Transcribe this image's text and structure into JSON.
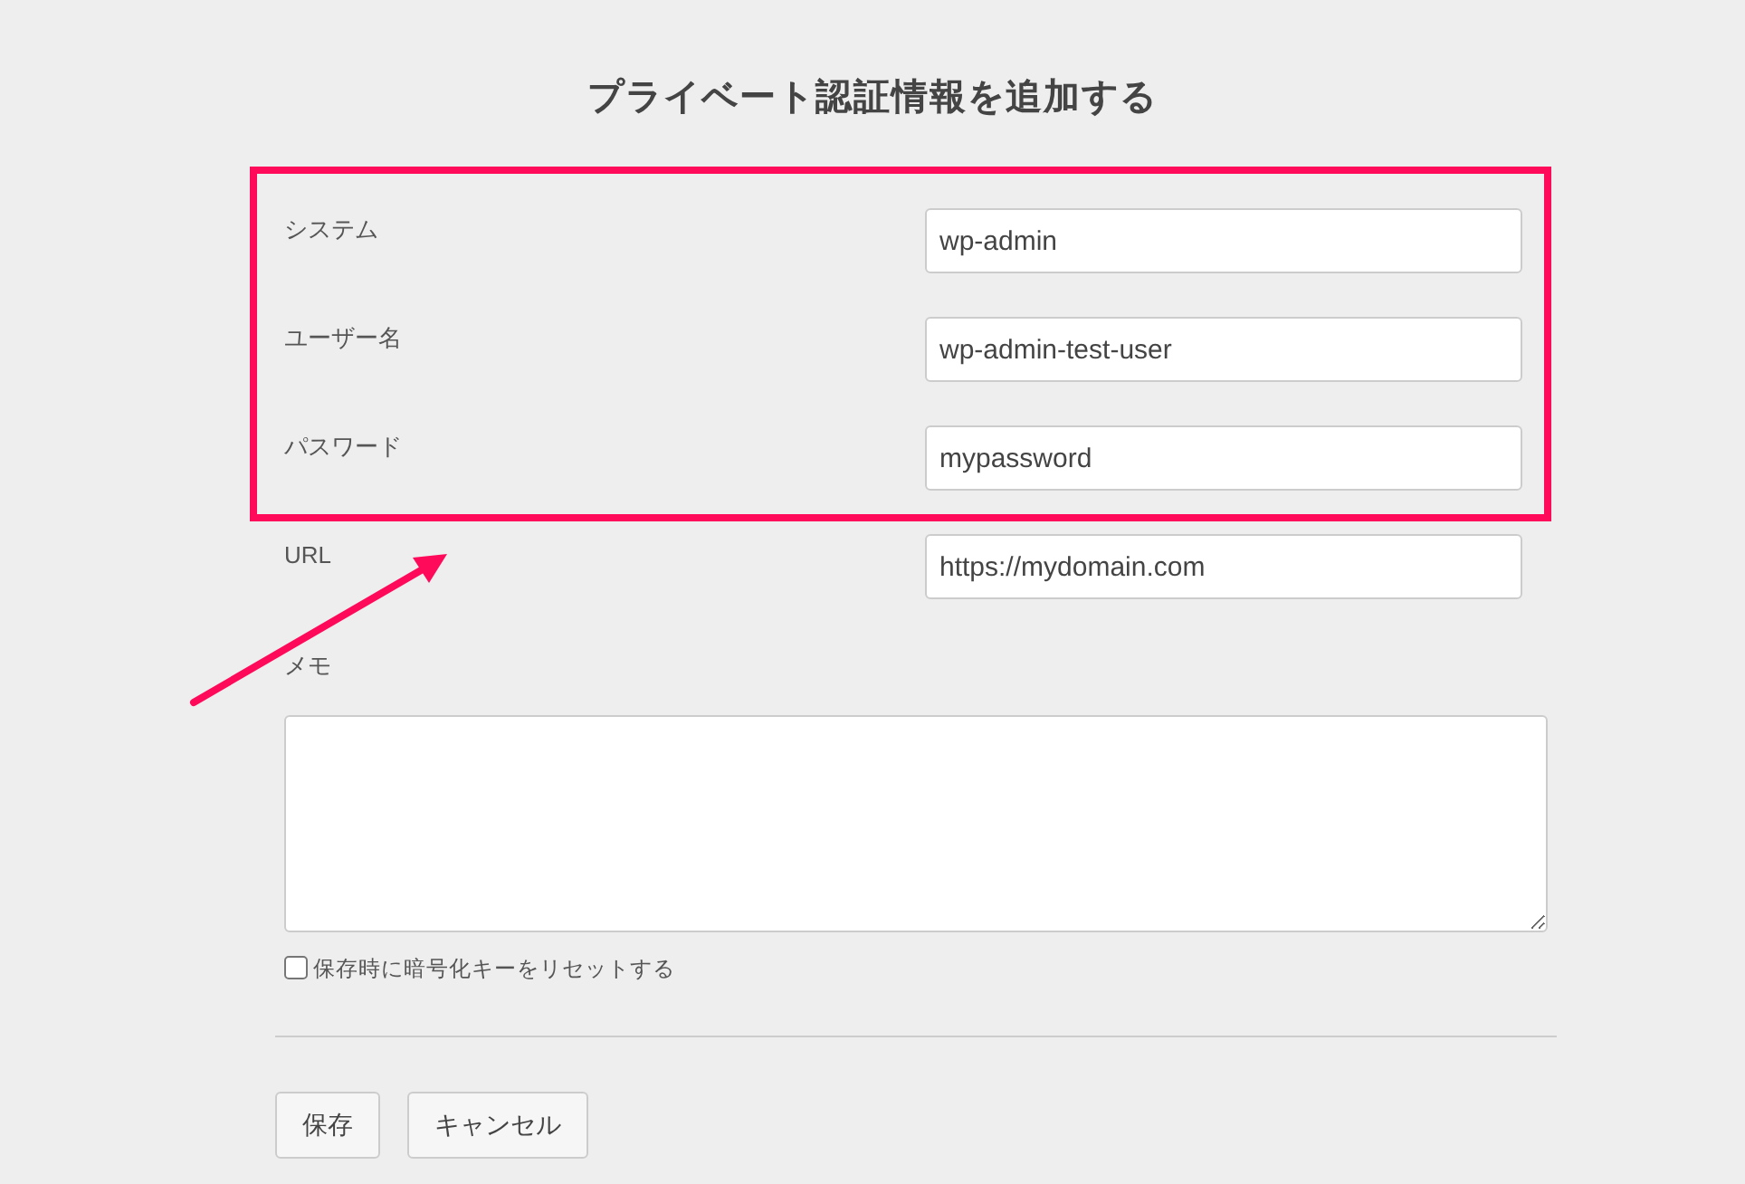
{
  "title": "プライベート認証情報を追加する",
  "fields": [
    {
      "label": "システム",
      "value": "wp-admin",
      "highlighted": true
    },
    {
      "label": "ユーザー名",
      "value": "wp-admin-test-user",
      "highlighted": true
    },
    {
      "label": "パスワード",
      "value": "mypassword",
      "highlighted": true
    },
    {
      "label": "URL",
      "value": "https://mydomain.com",
      "highlighted": false
    }
  ],
  "memo": {
    "label": "メモ"
  },
  "reset_key": {
    "label": "保存時に暗号化キーをリセットする",
    "checked": false
  },
  "buttons": [
    "保存",
    "キャンセル"
  ]
}
